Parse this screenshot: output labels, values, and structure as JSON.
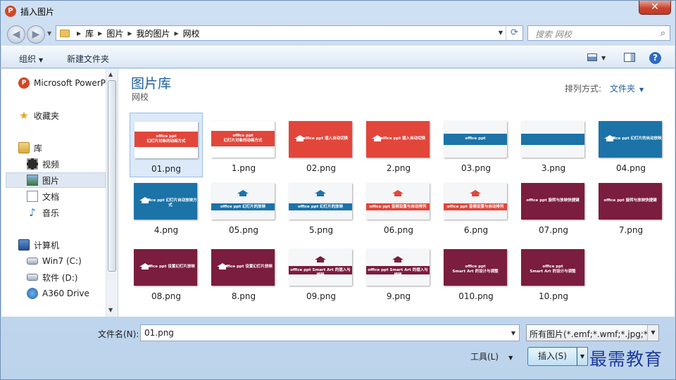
{
  "window": {
    "app_icon": "P",
    "title": "插入图片",
    "close_glyph": "✕"
  },
  "address": {
    "breadcrumbs": [
      "库",
      "图片",
      "我的图片",
      "网校"
    ],
    "search_placeholder": "搜索 网校"
  },
  "commands": {
    "organize": "组织",
    "new_folder": "新建文件夹"
  },
  "sidebar": {
    "items": [
      {
        "label": "Microsoft PowerPoint",
        "icon": "powerpoint-icon"
      },
      {
        "label": "收藏夹",
        "icon": "star-icon"
      },
      {
        "label": "库",
        "icon": "library-icon"
      },
      {
        "label": "视频",
        "icon": "video-icon"
      },
      {
        "label": "图片",
        "icon": "picture-icon"
      },
      {
        "label": "文档",
        "icon": "document-icon"
      },
      {
        "label": "音乐",
        "icon": "music-icon"
      },
      {
        "label": "计算机",
        "icon": "computer-icon"
      },
      {
        "label": "Win7 (C:)",
        "icon": "windows-drive-icon"
      },
      {
        "label": "软件 (D:)",
        "icon": "drive-icon"
      },
      {
        "label": "A360 Drive",
        "icon": "network-drive-icon"
      }
    ]
  },
  "main": {
    "library_title": "图片库",
    "library_subtitle": "网校",
    "arrange_label": "排列方式:",
    "arrange_value": "文件夹"
  },
  "files": [
    {
      "name": "01.png",
      "style": "white-red",
      "text": "office ppt\n幻灯片对象的动画方式"
    },
    {
      "name": "1.png",
      "style": "white-red",
      "text": "office ppt\n幻灯片对象的动画方式"
    },
    {
      "name": "02.png",
      "style": "red",
      "text": "office ppt 插入自动切换"
    },
    {
      "name": "2.png",
      "style": "red",
      "text": "office ppt 插入自动切换"
    },
    {
      "name": "03.png",
      "style": "white-blue",
      "text": "office ppt"
    },
    {
      "name": "3.png",
      "style": "white-blue",
      "text": ""
    },
    {
      "name": "04.png",
      "style": "blue",
      "text": "office ppt 幻灯片的自动放映"
    },
    {
      "name": "4.png",
      "style": "blue",
      "text": "office ppt 幻灯片自动放映方式"
    },
    {
      "name": "05.png",
      "style": "white-cap-blue",
      "text": "office ppt 幻灯片的放映"
    },
    {
      "name": "5.png",
      "style": "white-cap-blue",
      "text": "office ppt 幻灯片的放映"
    },
    {
      "name": "06.png",
      "style": "white-cap-red",
      "text": "office ppt 音频设置与自动排列"
    },
    {
      "name": "6.png",
      "style": "white-cap-red",
      "text": "office ppt 音频设置与自动排列"
    },
    {
      "name": "07.png",
      "style": "maroon",
      "text": "office ppt 旋转与放映快捷键"
    },
    {
      "name": "7.png",
      "style": "maroon",
      "text": "office ppt 旋转与放映快捷键"
    },
    {
      "name": "08.png",
      "style": "maroon-cap",
      "text": "office ppt 设置幻灯片放映"
    },
    {
      "name": "8.png",
      "style": "maroon-cap",
      "text": "office ppt 设置幻灯片放映"
    },
    {
      "name": "09.png",
      "style": "white-maroon",
      "text": "office ppt Smart Art 的插入与编辑"
    },
    {
      "name": "9.png",
      "style": "white-maroon",
      "text": "office ppt Smart Art 的插入与编辑"
    },
    {
      "name": "010.png",
      "style": "maroon",
      "text": "office ppt\nSmart Art 的设计与调整"
    },
    {
      "name": "10.png",
      "style": "maroon",
      "text": "office ppt\nSmart Art 的设计与调整"
    }
  ],
  "bottom": {
    "filename_label": "文件名(N):",
    "filename_value": "01.png",
    "filetype_value": "所有图片(*.emf;*.wmf;*.jpg;*.jpeg;*.png)",
    "tools_label": "工具(L)",
    "insert_label": "插入(S)"
  },
  "watermark": "最需教育",
  "colors": {
    "accent_blue": "#1e5f9e",
    "thumb_red": "#e2463b",
    "thumb_blue": "#1b73a8",
    "thumb_maroon": "#7a1d3e"
  }
}
